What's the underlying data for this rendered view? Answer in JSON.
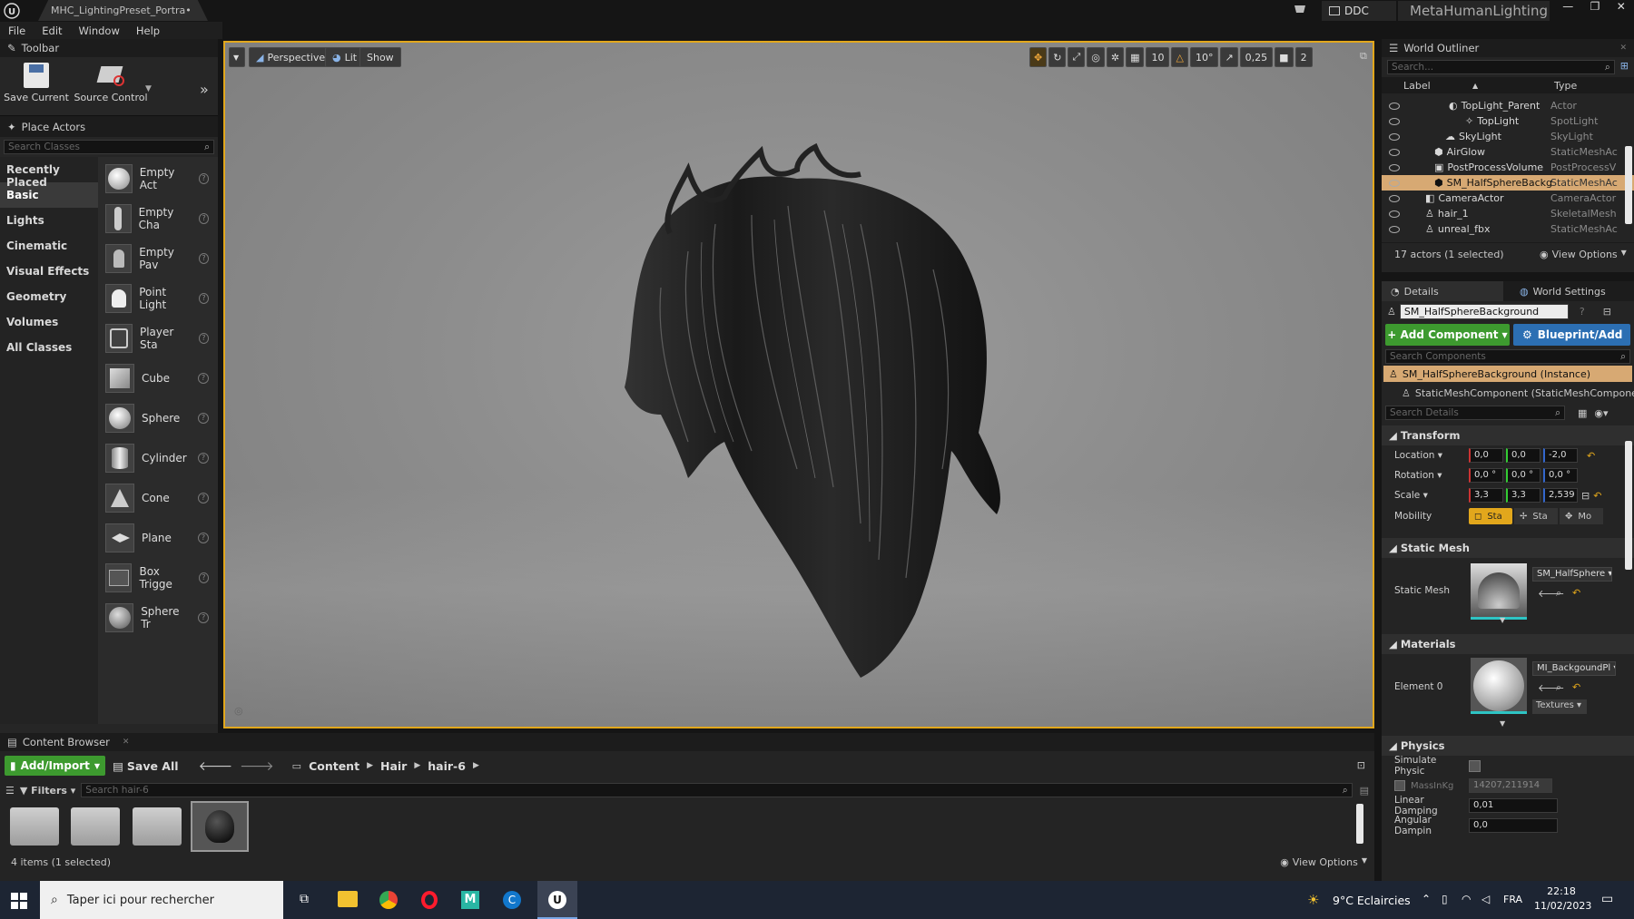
{
  "window": {
    "tab_title": "MHC_LightingPreset_Portra•",
    "ddc_label": "DDC",
    "project_name": "MetaHumanLighting"
  },
  "menu": [
    "File",
    "Edit",
    "Window",
    "Help"
  ],
  "toolbar": {
    "title": "Toolbar",
    "save_label": "Save Current",
    "source_label": "Source Control"
  },
  "place_actors": {
    "title": "Place Actors",
    "search_placeholder": "Search Classes",
    "categories": [
      "Recently Placed",
      "Basic",
      "Lights",
      "Cinematic",
      "Visual Effects",
      "Geometry",
      "Volumes",
      "All Classes"
    ],
    "actors": [
      "Empty Act",
      "Empty Cha",
      "Empty Pav",
      "Point Light",
      "Player Sta",
      "Cube",
      "Sphere",
      "Cylinder",
      "Cone",
      "Plane",
      "Box Trigge",
      "Sphere Tr"
    ]
  },
  "viewport": {
    "perspective": "Perspective",
    "lit": "Lit",
    "show": "Show",
    "grid": "10",
    "angle": "10°",
    "scale": "0,25",
    "cam_speed": "2"
  },
  "outliner": {
    "title": "World Outliner",
    "search_placeholder": "Search...",
    "col_label": "Label",
    "col_type": "Type",
    "rows": [
      {
        "label": "TopLight_Parent",
        "type": "Actor"
      },
      {
        "label": "TopLight",
        "type": "SpotLight"
      },
      {
        "label": "SkyLight",
        "type": "SkyLight"
      },
      {
        "label": "AirGlow",
        "type": "StaticMeshAc"
      },
      {
        "label": "PostProcessVolume",
        "type": "PostProcessV"
      },
      {
        "label": "SM_HalfSphereBackg",
        "type": "StaticMeshAc"
      },
      {
        "label": "CameraActor",
        "type": "CameraActor"
      },
      {
        "label": "hair_1",
        "type": "SkeletalMesh"
      },
      {
        "label": "unreal_fbx",
        "type": "StaticMeshAc"
      }
    ],
    "status": "17 actors (1 selected)",
    "view_options": "View Options"
  },
  "details": {
    "tab_details": "Details",
    "tab_world": "World Settings",
    "object_name": "SM_HalfSphereBackground",
    "add_component": "+ Add Component",
    "blueprint": "Blueprint/Add",
    "search_components": "Search Components",
    "instance": "SM_HalfSphereBackground (Instance)",
    "component": "StaticMeshComponent (StaticMeshComponent",
    "search_details": "Search Details",
    "transform": "Transform",
    "location_label": "Location",
    "location": [
      "0,0",
      "0,0",
      "-2,0"
    ],
    "rotation_label": "Rotation",
    "rotation": [
      "0,0 °",
      "0,0 °",
      "0,0 °"
    ],
    "scale_label": "Scale",
    "scale": [
      "3,3",
      "3,3",
      "2,539"
    ],
    "mobility_label": "Mobility",
    "mobility": [
      "Sta",
      "Sta",
      "Mo"
    ],
    "static_mesh_section": "Static Mesh",
    "static_mesh_label": "Static Mesh",
    "static_mesh_value": "SM_HalfSphere",
    "materials_section": "Materials",
    "element_label": "Element 0",
    "material_value": "MI_BackgoundPl",
    "textures": "Textures",
    "physics_section": "Physics",
    "simulate": "Simulate Physic",
    "mass_label": "MassInKg",
    "mass_value": "14207,211914",
    "linear_label": "Linear Damping",
    "linear_value": "0,01",
    "angular_label": "Angular Dampin",
    "angular_value": "0,0"
  },
  "content_browser": {
    "title": "Content Browser",
    "add_import": "Add/Import",
    "save_all": "Save All",
    "path": [
      "Content",
      "Hair",
      "hair-6"
    ],
    "filters": "Filters",
    "search_placeholder": "Search hair-6",
    "status": "4 items (1 selected)",
    "view_options": "View Options"
  },
  "taskbar": {
    "search_placeholder": "Taper ici pour rechercher",
    "weather": "9°C Eclaircies",
    "lang": "FRA",
    "time": "22:18",
    "date": "11/02/2023"
  },
  "colors": {
    "accent_green": "#3d9a2f",
    "accent_blue": "#2c6fb3",
    "selection": "#d7a973",
    "viewport_border": "#e2a71c"
  }
}
